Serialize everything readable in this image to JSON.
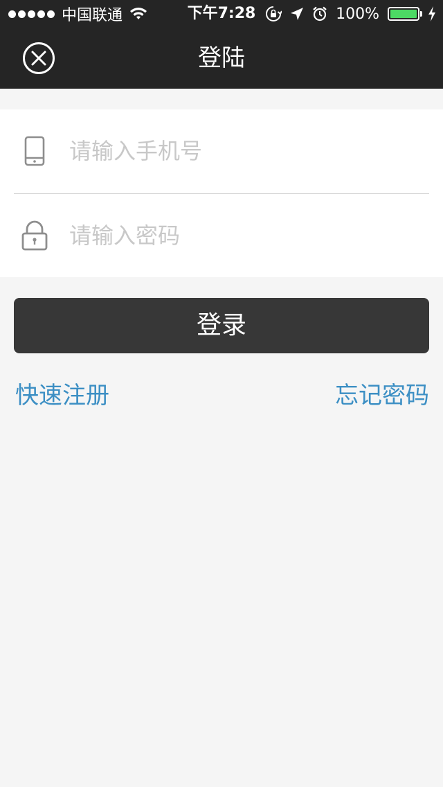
{
  "status_bar": {
    "carrier": "中国联通",
    "time": "下午7:28",
    "battery_percent": "100%",
    "battery_level": 1.0,
    "battery_color": "#4cd964"
  },
  "nav": {
    "title": "登陆",
    "close_icon": "close-circle-icon"
  },
  "form": {
    "phone": {
      "placeholder": "请输入手机号",
      "value": "",
      "icon": "mobile-phone-icon"
    },
    "password": {
      "placeholder": "请输入密码",
      "value": "",
      "icon": "lock-icon"
    }
  },
  "actions": {
    "login_label": "登录",
    "register_label": "快速注册",
    "forgot_label": "忘记密码"
  },
  "colors": {
    "header_bg": "#252525",
    "button_bg": "#373737",
    "link": "#3c8fc4",
    "page_bg": "#f5f5f5"
  }
}
